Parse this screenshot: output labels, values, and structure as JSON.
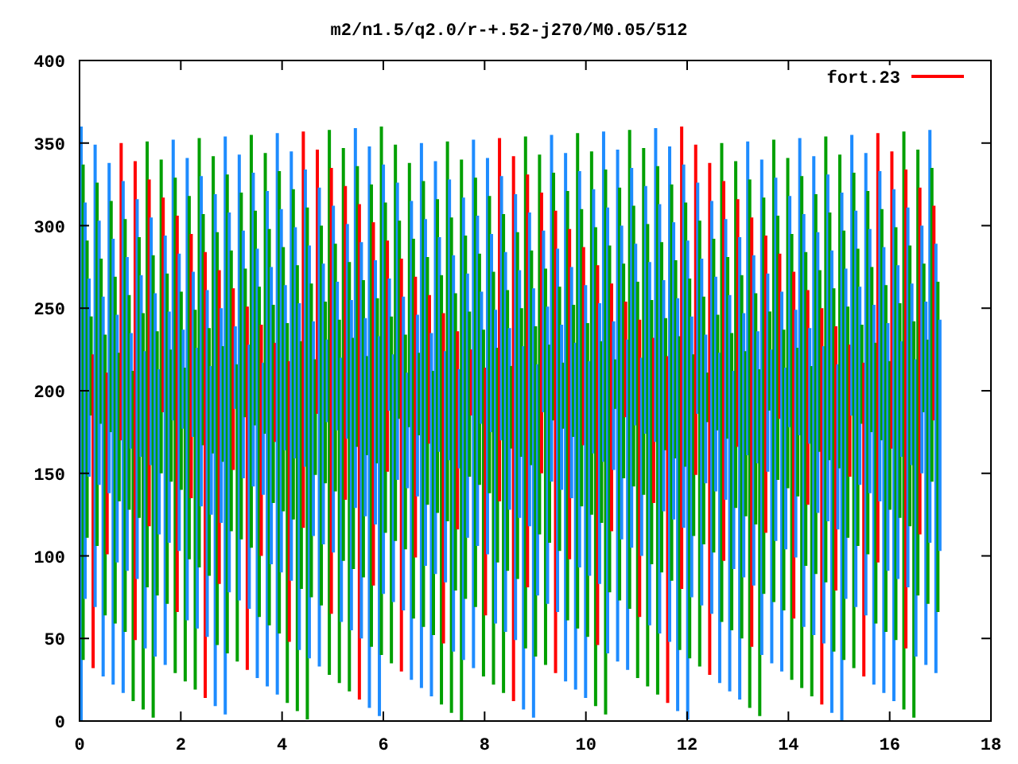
{
  "title": "m2/n1.5/q2.0/r-+.52-j270/M0.05/512",
  "legend": {
    "label": "fort.23",
    "color": "#ff0000"
  },
  "x_ticks": [
    "0",
    "2",
    "4",
    "6",
    "8",
    "10",
    "12",
    "14",
    "16",
    "18"
  ],
  "y_ticks": [
    "400",
    "350",
    "300",
    "250",
    "200",
    "150",
    "100",
    "50",
    "0"
  ]
}
